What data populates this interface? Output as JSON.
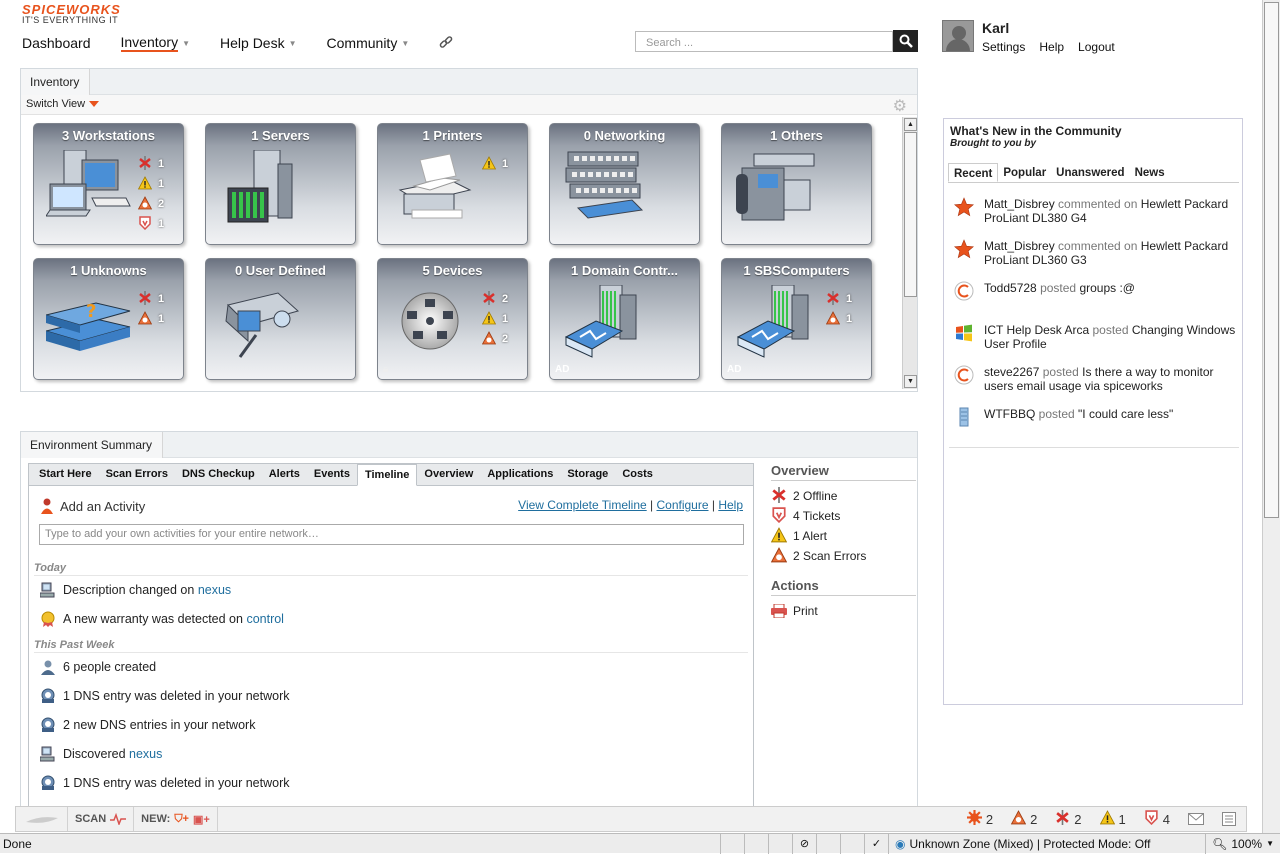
{
  "header": {
    "brand": "SPICEWORKS",
    "tagline": "IT'S EVERYTHING IT",
    "nav": [
      {
        "label": "Dashboard",
        "active": false,
        "dropdown": false
      },
      {
        "label": "Inventory",
        "active": true,
        "dropdown": true
      },
      {
        "label": "Help Desk",
        "active": false,
        "dropdown": true
      },
      {
        "label": "Community",
        "active": false,
        "dropdown": true
      }
    ],
    "search_placeholder": "Search ...",
    "user": {
      "name": "Karl",
      "links": [
        "Settings",
        "Help",
        "Logout"
      ]
    }
  },
  "inventory": {
    "title": "Inventory",
    "switch_view": "Switch View",
    "tiles": [
      {
        "title": "3 Workstations",
        "icon": "workstations",
        "stats": [
          {
            "icon": "offline",
            "count": "1"
          },
          {
            "icon": "alert",
            "count": "1"
          },
          {
            "icon": "scan-error",
            "count": "2"
          },
          {
            "icon": "ticket",
            "count": "1"
          }
        ],
        "badge": ""
      },
      {
        "title": "1 Servers",
        "icon": "servers",
        "stats": [],
        "badge": ""
      },
      {
        "title": "1 Printers",
        "icon": "printers",
        "stats": [
          {
            "icon": "alert",
            "count": "1"
          }
        ],
        "badge": ""
      },
      {
        "title": "0 Networking",
        "icon": "networking",
        "stats": [],
        "badge": ""
      },
      {
        "title": "1 Others",
        "icon": "others",
        "stats": [],
        "badge": ""
      },
      {
        "title": "1 Unknowns",
        "icon": "unknowns",
        "stats": [
          {
            "icon": "offline",
            "count": "1"
          },
          {
            "icon": "scan-error",
            "count": "1"
          }
        ],
        "badge": ""
      },
      {
        "title": "0 User Defined",
        "icon": "user-defined",
        "stats": [],
        "badge": ""
      },
      {
        "title": "5 Devices",
        "icon": "devices",
        "stats": [
          {
            "icon": "offline",
            "count": "2"
          },
          {
            "icon": "alert",
            "count": "1"
          },
          {
            "icon": "scan-error",
            "count": "2"
          }
        ],
        "badge": "lock"
      },
      {
        "title": "1 Domain Contr...",
        "icon": "domain-controllers",
        "stats": [],
        "badge": "AD"
      },
      {
        "title": "1 SBSComputers",
        "icon": "sbs-computers",
        "stats": [
          {
            "icon": "offline",
            "count": "1"
          },
          {
            "icon": "scan-error",
            "count": "1"
          }
        ],
        "badge": "AD"
      }
    ]
  },
  "environment": {
    "title": "Environment Summary",
    "tabs": [
      "Start Here",
      "Scan Errors",
      "DNS Checkup",
      "Alerts",
      "Events",
      "Timeline",
      "Overview",
      "Applications",
      "Storage",
      "Costs"
    ],
    "active_tab": "Timeline",
    "add_activity": "Add an Activity",
    "timeline_links": [
      "View Complete Timeline",
      "Configure",
      "Help"
    ],
    "activity_placeholder": "Type to add your own activities for your entire network…",
    "sections": {
      "today": "Today",
      "past_week": "This Past Week"
    },
    "today_items": [
      {
        "icon": "computer",
        "text": "Description changed on ",
        "link": "nexus"
      },
      {
        "icon": "warranty",
        "text": "A new warranty was detected on ",
        "link": "control"
      }
    ],
    "week_items": [
      {
        "icon": "person",
        "text": "6 people created",
        "link": ""
      },
      {
        "icon": "dns",
        "text": "1 DNS entry was deleted in your network",
        "link": ""
      },
      {
        "icon": "dns",
        "text": "2 new DNS entries in your network",
        "link": ""
      },
      {
        "icon": "computer",
        "text": "Discovered ",
        "link": "nexus"
      },
      {
        "icon": "dns",
        "text": "1 DNS entry was deleted in your network",
        "link": ""
      }
    ],
    "overview": {
      "title": "Overview",
      "items": [
        {
          "icon": "offline",
          "text": "2 Offline"
        },
        {
          "icon": "ticket",
          "text": "4 Tickets"
        },
        {
          "icon": "alert",
          "text": "1 Alert"
        },
        {
          "icon": "scan-error",
          "text": "2 Scan Errors"
        }
      ]
    },
    "actions": {
      "title": "Actions",
      "items": [
        {
          "icon": "printer",
          "text": "Print"
        }
      ]
    }
  },
  "community": {
    "title": "What's New in the Community",
    "subtitle": "Brought to you by",
    "tabs": [
      "Recent",
      "Popular",
      "Unanswered",
      "News"
    ],
    "active_tab": "Recent",
    "items": [
      {
        "icon": "star",
        "user": "Matt_Disbrey",
        "verb": "commented on",
        "subject": "Hewlett Packard ProLiant DL380 G4"
      },
      {
        "icon": "star",
        "user": "Matt_Disbrey",
        "verb": "commented on",
        "subject": "Hewlett Packard ProLiant DL360 G3"
      },
      {
        "icon": "spice",
        "user": "Todd5728",
        "verb": "posted",
        "subject": "groups :@"
      },
      {
        "icon": "windows",
        "user": "ICT Help Desk Arca",
        "verb": "posted",
        "subject": "Changing Windows User Profile"
      },
      {
        "icon": "spice",
        "user": "steve2267",
        "verb": "posted",
        "subject": "Is there a way to monitor users email usage via spiceworks"
      },
      {
        "icon": "server",
        "user": "WTFBBQ",
        "verb": "posted",
        "subject": "\"I could care less\""
      }
    ]
  },
  "bottom_bar": {
    "scan_label": "SCAN",
    "new_label": "NEW:",
    "counts": [
      {
        "icon": "scan-error-cluster",
        "count": "2"
      },
      {
        "icon": "scan-error",
        "count": "2"
      },
      {
        "icon": "offline",
        "count": "2"
      },
      {
        "icon": "alert",
        "count": "1"
      },
      {
        "icon": "ticket",
        "count": "4"
      }
    ]
  },
  "status_bar": {
    "status": "Done",
    "zone": "Unknown Zone (Mixed) | Protected Mode: Off",
    "zoom": "100%"
  },
  "colors": {
    "accent": "#e8531d",
    "link": "#1f6e9e"
  }
}
